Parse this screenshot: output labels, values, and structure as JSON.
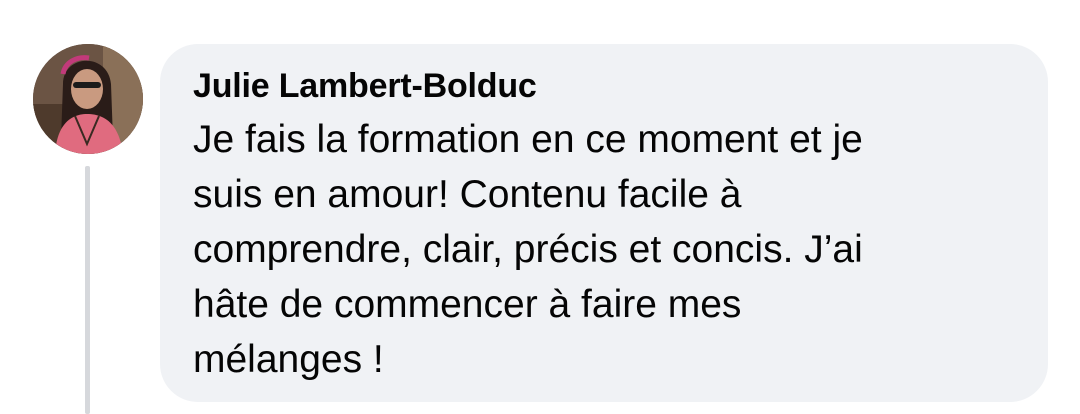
{
  "comment": {
    "author": "Julie Lambert-Bolduc",
    "text": "Je fais la formation en ce moment et je\nsuis en amour! Contenu facile à\ncomprendre, clair, précis et concis. J’ai\nhâte de commencer à faire mes\nmélanges !",
    "avatar_icon": "profile-photo",
    "bubble_color": "#f0f2f5",
    "thread_line_color": "#d6d8dc"
  }
}
